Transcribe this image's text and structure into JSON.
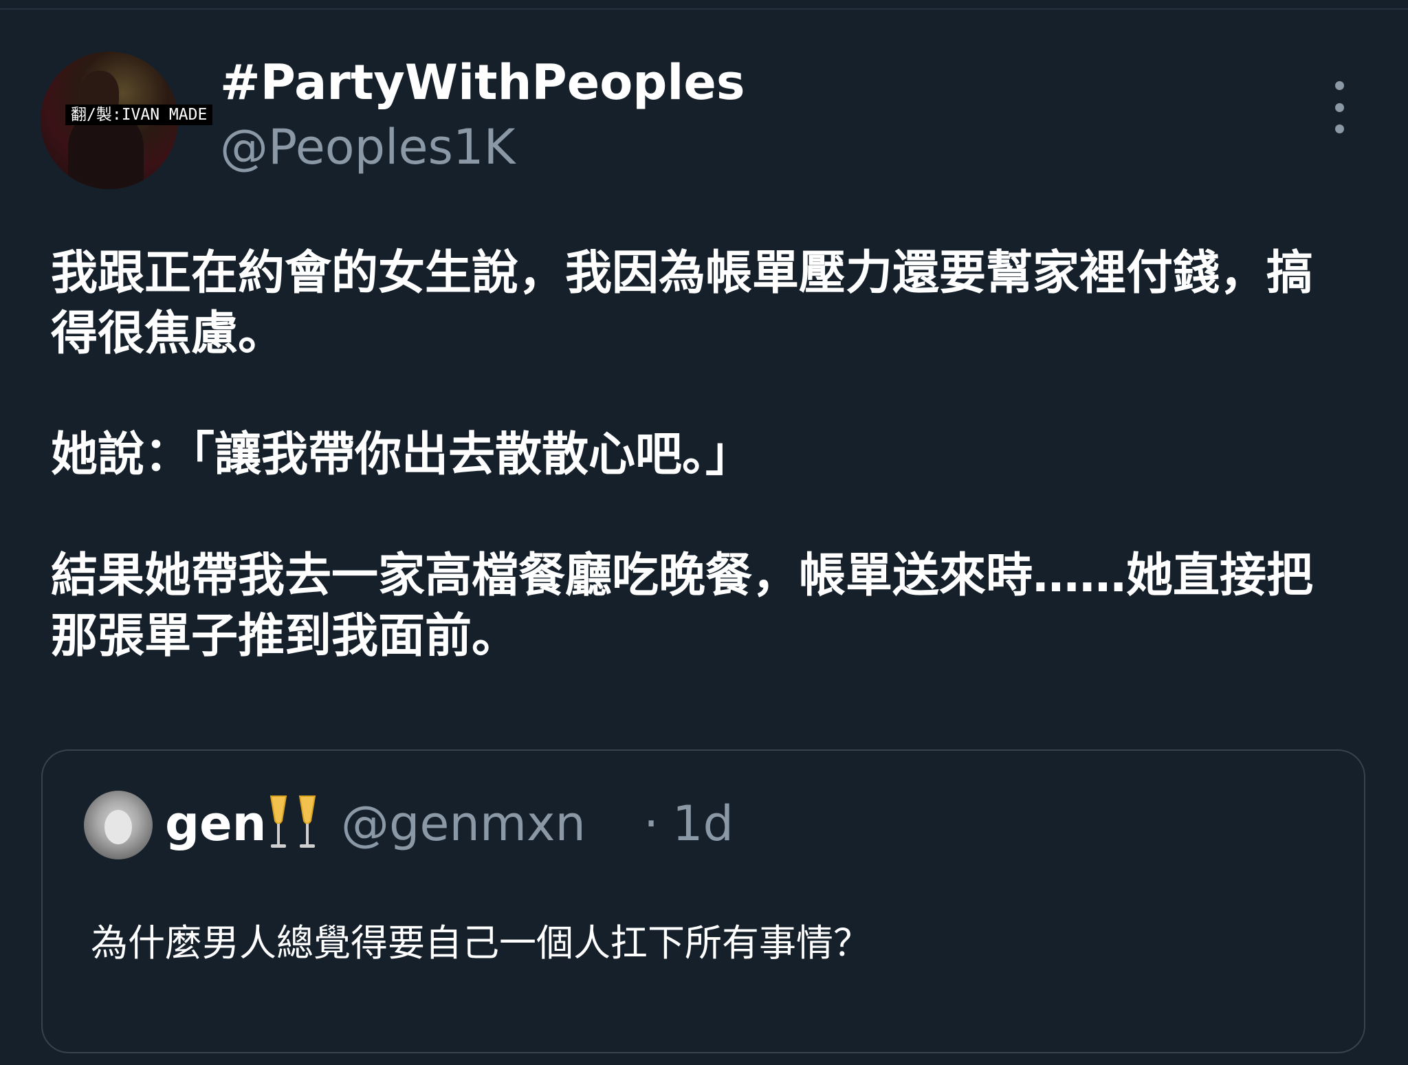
{
  "tweet": {
    "avatar_watermark": "翻/製:IVAN MADE",
    "display_name": "#PartyWithPeoples",
    "handle": "@Peoples1K",
    "more_icon": "more-vertical-icon",
    "paragraphs": [
      "我跟正在約會的女生說，我因為帳單壓力還要幫家裡付錢，搞得很焦慮。",
      "她說：「讓我帶你出去散散心吧。」",
      "結果她帶我去一家高檔餐廳吃晚餐，帳單送來時……她直接把那張單子推到我面前。"
    ]
  },
  "quote": {
    "display_name": "gen",
    "emoji_icon": "clinking-glasses-icon",
    "handle": "@genmxn",
    "separator": "·",
    "time": "1d",
    "text": "為什麼男人總覺得要自己一個人扛下所有事情？"
  },
  "colors": {
    "background": "#15202b",
    "primary_text": "#ffffff",
    "secondary_text": "#8b98a5",
    "border": "#38444d"
  }
}
